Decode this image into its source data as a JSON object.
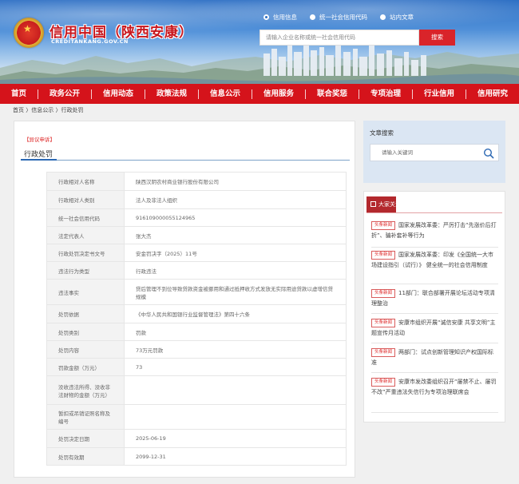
{
  "header": {
    "title": "信用中国（陕西安康）",
    "domain": "CREDITANKANG.GOV.CN",
    "radios": [
      {
        "label": "信用信息",
        "selected": true
      },
      {
        "label": "统一社会信用代码",
        "selected": false
      },
      {
        "label": "站内文章",
        "selected": false
      }
    ],
    "search_placeholder": "请输入企业名称或统一社会信用代码",
    "search_button": "搜索"
  },
  "nav": [
    "首页",
    "政务公开",
    "信用动态",
    "政策法规",
    "信息公示",
    "信用服务",
    "联合奖惩",
    "专项治理",
    "行业信用",
    "信用研究"
  ],
  "breadcrumb": "首页 〉信息公示 〉行政处罚",
  "main": {
    "tag": "【异议申诉】",
    "title": "行政处罚",
    "rows": [
      {
        "k": "行政相对人名称",
        "v": "陕西汉阴农村商业银行股份有限公司"
      },
      {
        "k": "行政相对人类别",
        "v": "法人及非法人组织"
      },
      {
        "k": "统一社会信用代码",
        "v": "916109000055124965"
      },
      {
        "k": "法定代表人",
        "v": "张大杰"
      },
      {
        "k": "行政处罚决定书文号",
        "v": "安金罚决字（2025）11号"
      },
      {
        "k": "违法行为类型",
        "v": "行政违法"
      },
      {
        "k": "违法事实",
        "v": "贷后管理不到位导致贷款资金被挪用和通过抵押收方式发放无实际用途贷款以虚增信贷规模"
      },
      {
        "k": "处罚依据",
        "v": "《中华人民共和国银行业监督管理法》第四十六条"
      },
      {
        "k": "处罚类别",
        "v": "罚款"
      },
      {
        "k": "处罚内容",
        "v": "73万元罚款"
      },
      {
        "k": "罚款金额（万元）",
        "v": "73"
      },
      {
        "k": "没收违法所得、没收非法财物的金额（万元）",
        "v": ""
      },
      {
        "k": "暂扣或吊销证照名称及编号",
        "v": ""
      },
      {
        "k": "处罚决定日期",
        "v": "2025-06-19"
      },
      {
        "k": "处罚有效期",
        "v": "2099-12-31"
      }
    ]
  },
  "sidebar": {
    "search_title": "文章搜索",
    "keyword_placeholder": "请输入关键词",
    "focus_title": "大家关注",
    "news": [
      {
        "badge": "头条新闻",
        "text": "国家发展改革委：严厉打击“先涨价后打折”、骗补套补等行为"
      },
      {
        "badge": "头条新闻",
        "text": "国家发展改革委：印发《全国统一大市场建设指引（试行）》 健全统一的社会信用制度"
      },
      {
        "badge": "头条新闻",
        "text": "11部门：联合部署开展论坛活动专项清理整治"
      },
      {
        "badge": "头条新闻",
        "text": "安康市组织开展“诚信安康 共享文明”主题宣传月活动"
      },
      {
        "badge": "头条新闻",
        "text": "两部门：试点创新管理知识产权国际标准"
      },
      {
        "badge": "头条新闻",
        "text": "安康市发改委组织召开“屡禁不止、屡罚不改”严重违法失信行为专项治理联席会"
      }
    ]
  }
}
